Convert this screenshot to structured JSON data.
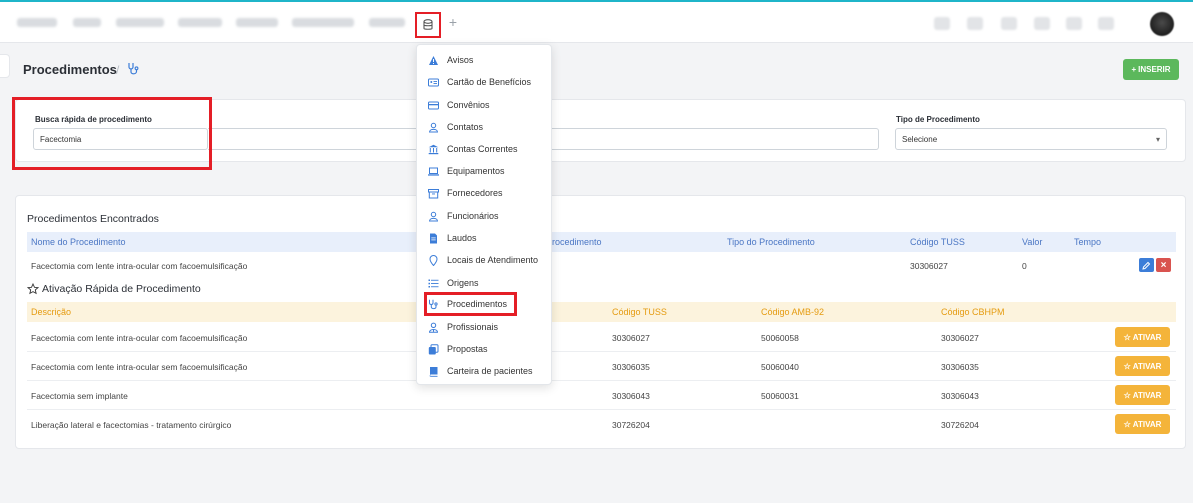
{
  "header": {
    "nav_icon_name": "database-icon",
    "plus_icon": "+"
  },
  "page": {
    "title": "Procedimentos",
    "separator": "/",
    "title_icon": "stethoscope-icon"
  },
  "toolbar": {
    "insert_label": "INSERIR",
    "insert_icon": "+"
  },
  "search": {
    "quick_label": "Busca rápida de procedimento",
    "quick_value": "Facectomia",
    "type_label": "Tipo de Procedimento",
    "type_value": "Selecione"
  },
  "found": {
    "title": "Procedimentos Encontrados",
    "columns": [
      "Nome do Procedimento",
      "rocedimento",
      "Tipo do Procedimento",
      "Código TUSS",
      "Valor",
      "Tempo"
    ],
    "rows": [
      {
        "name": "Facectomia com lente intra-ocular com facoemulsificação",
        "tuss": "30306027",
        "valor": "0"
      }
    ]
  },
  "activation": {
    "title": "Ativação Rápida de Procedimento",
    "columns": [
      "Descrição",
      "Código TUSS",
      "Código AMB-92",
      "Código CBHPM"
    ],
    "button_label": "ATIVAR",
    "rows": [
      {
        "descricao": "Facectomia com lente intra-ocular com facoemulsificação",
        "tuss": "30306027",
        "amb": "50060058",
        "cbhpm": "30306027"
      },
      {
        "descricao": "Facectomia com lente intra-ocular sem facoemulsificação",
        "tuss": "30306035",
        "amb": "50060040",
        "cbhpm": "30306035"
      },
      {
        "descricao": "Facectomia sem implante",
        "tuss": "30306043",
        "amb": "50060031",
        "cbhpm": "30306043"
      },
      {
        "descricao": "Liberação lateral e facectomias - tratamento cirúrgico",
        "tuss": "30726204",
        "amb": "",
        "cbhpm": "30726204"
      }
    ]
  },
  "menu": {
    "items": [
      {
        "label": "Avisos",
        "icon": "warning-icon"
      },
      {
        "label": "Cartão de Benefícios",
        "icon": "id-card-icon"
      },
      {
        "label": "Convênios",
        "icon": "credit-card-icon"
      },
      {
        "label": "Contatos",
        "icon": "user-icon"
      },
      {
        "label": "Contas Correntes",
        "icon": "bank-icon"
      },
      {
        "label": "Equipamentos",
        "icon": "laptop-icon"
      },
      {
        "label": "Fornecedores",
        "icon": "archive-icon"
      },
      {
        "label": "Funcionários",
        "icon": "user-icon"
      },
      {
        "label": "Laudos",
        "icon": "document-icon"
      },
      {
        "label": "Locais de Atendimento",
        "icon": "location-pin-icon"
      },
      {
        "label": "Origens",
        "icon": "list-icon"
      },
      {
        "label": "Procedimentos",
        "icon": "stethoscope-icon"
      },
      {
        "label": "Profissionais",
        "icon": "user-doctor-icon"
      },
      {
        "label": "Propostas",
        "icon": "copy-icon"
      },
      {
        "label": "Carteira de pacientes",
        "icon": "book-icon"
      }
    ]
  },
  "colors": {
    "accent_blue": "#3c7dd8",
    "success_green": "#5cb85c",
    "warning_orange": "#f4b43a",
    "highlight_red": "#e41e26"
  }
}
